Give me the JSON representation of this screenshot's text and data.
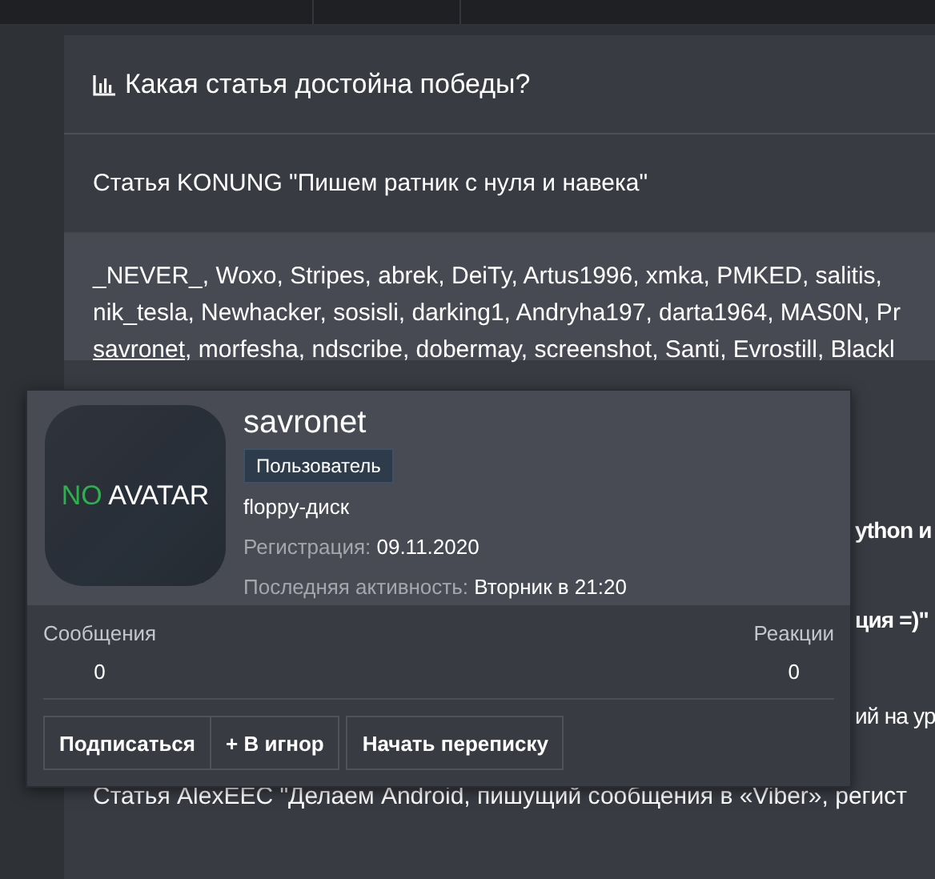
{
  "poll": {
    "title": "Какая статья достойна победы?",
    "first_option": "Статья KONUNG \"Пишем ратник с нуля и навека\"",
    "voters": [
      [
        {
          "text": "_NEVER_, Woxo, Stripes, abrek, DeiTy, Artus1996, xmka, PMKED, salitis,",
          "link": false
        }
      ],
      [
        {
          "text": "nik_tesla, Newhacker, sosisli, darking1, Andryha197, darta1964, MAS0N, Pr",
          "link": false
        }
      ],
      [
        {
          "text": "savronet",
          "link": true
        },
        {
          "text": ", morfesha, ndscribe, dobermay, screenshot, Santi, Evrostill, Blackl",
          "link": false
        }
      ]
    ],
    "covered_rows": [
      {
        "text": "ython и",
        "bold": true
      },
      {
        "text": "ция =)\"",
        "bold": true
      },
      {
        "text": "ий на ур",
        "bold": false
      },
      {
        "text": "Статья AlexEEC \"Делаем Android, пишущий сообщения в «Viber», регист",
        "bold": false
      }
    ]
  },
  "user_card": {
    "avatar": {
      "first": "NO",
      "second": "AVATAR"
    },
    "username": "savronet",
    "role": "Пользователь",
    "user_title": "floppy-диск",
    "facts": [
      {
        "label": "Регистрация:",
        "value": "09.11.2020"
      },
      {
        "label": "Последняя активность:",
        "value": "Вторник в 21:20"
      }
    ],
    "stats": [
      {
        "label": "Сообщения",
        "value": "0"
      },
      {
        "label": "Реакции",
        "value": "0"
      }
    ],
    "actions": [
      {
        "label": "Подписаться",
        "kind": "joined"
      },
      {
        "label": "+ В игнор",
        "kind": "joined"
      },
      {
        "label": "Начать переписку",
        "kind": "single"
      }
    ]
  }
}
